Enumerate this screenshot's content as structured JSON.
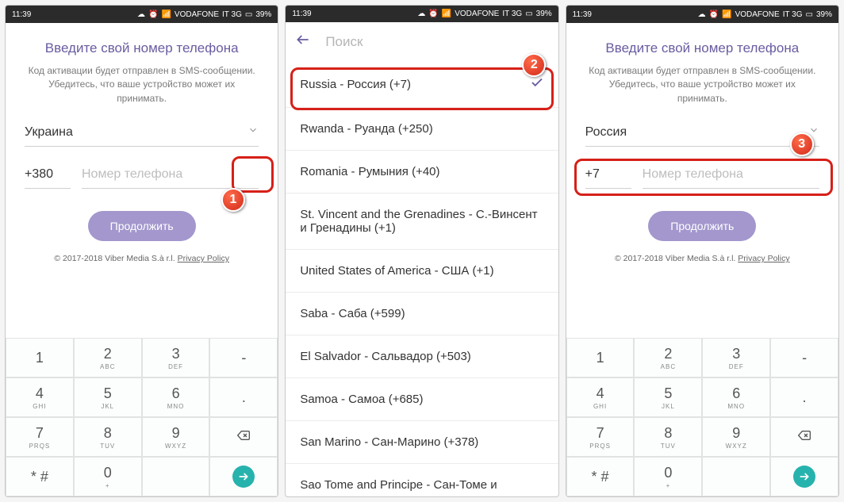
{
  "statusbar": {
    "time": "11:39",
    "carrier": "VODAFONE",
    "net": "IT 3G",
    "battery": "39%",
    "icons": {
      "cloud": "cloud-icon",
      "alarm": "alarm-icon",
      "wifi": "wifi-icon",
      "signal": "signal-icon",
      "battery": "battery-icon"
    }
  },
  "register_ua": {
    "heading": "Введите свой номер телефона",
    "subtext": "Код активации будет отправлен в SMS-сообщении. Убедитесь, что ваше устройство может их принимать.",
    "country_selected": "Украина",
    "code": "+380",
    "phone_placeholder": "Номер телефона",
    "continue": "Продолжить",
    "copyright": "© 2017-2018 Viber Media S.à r.l.",
    "privacy": "Privacy Policy"
  },
  "search_panel": {
    "search_placeholder": "Поиск",
    "items": [
      "Russia - Россия (+7)",
      "Rwanda - Руанда (+250)",
      "Romania - Румыния (+40)",
      "St. Vincent and the Grenadines - С.-Винсент и Гренадины (+1)",
      "United States of America - США (+1)",
      "Saba - Саба (+599)",
      "El Salvador - Сальвадор (+503)",
      "Samoa - Самоа (+685)",
      "San Marino - Сан-Марино (+378)",
      "Sao Tome and Principe - Сан-Томе и"
    ],
    "selected_index": 0
  },
  "register_ru": {
    "heading": "Введите свой номер телефона",
    "subtext": "Код активации будет отправлен в SMS-сообщении. Убедитесь, что ваше устройство может их принимать.",
    "country_selected": "Россия",
    "code": "+7",
    "phone_placeholder": "Номер телефона",
    "continue": "Продолжить",
    "copyright": "© 2017-2018 Viber Media S.à r.l.",
    "privacy": "Privacy Policy"
  },
  "keypad": {
    "rows": [
      [
        {
          "d": "1",
          "l": ""
        },
        {
          "d": "2",
          "l": "ABC"
        },
        {
          "d": "3",
          "l": "DEF"
        },
        {
          "d": "-",
          "l": ""
        }
      ],
      [
        {
          "d": "4",
          "l": "GHI"
        },
        {
          "d": "5",
          "l": "JKL"
        },
        {
          "d": "6",
          "l": "MNO"
        },
        {
          "d": ".",
          "l": ""
        }
      ],
      [
        {
          "d": "7",
          "l": "PRQS"
        },
        {
          "d": "8",
          "l": "TUV"
        },
        {
          "d": "9",
          "l": "WXYZ"
        },
        {
          "d": "bksp",
          "l": ""
        }
      ],
      [
        {
          "d": "* #",
          "l": ""
        },
        {
          "d": "0",
          "l": "+"
        },
        {
          "d": "",
          "l": ""
        },
        {
          "d": "go",
          "l": ""
        }
      ]
    ]
  },
  "badges": {
    "1": "1",
    "2": "2",
    "3": "3"
  }
}
